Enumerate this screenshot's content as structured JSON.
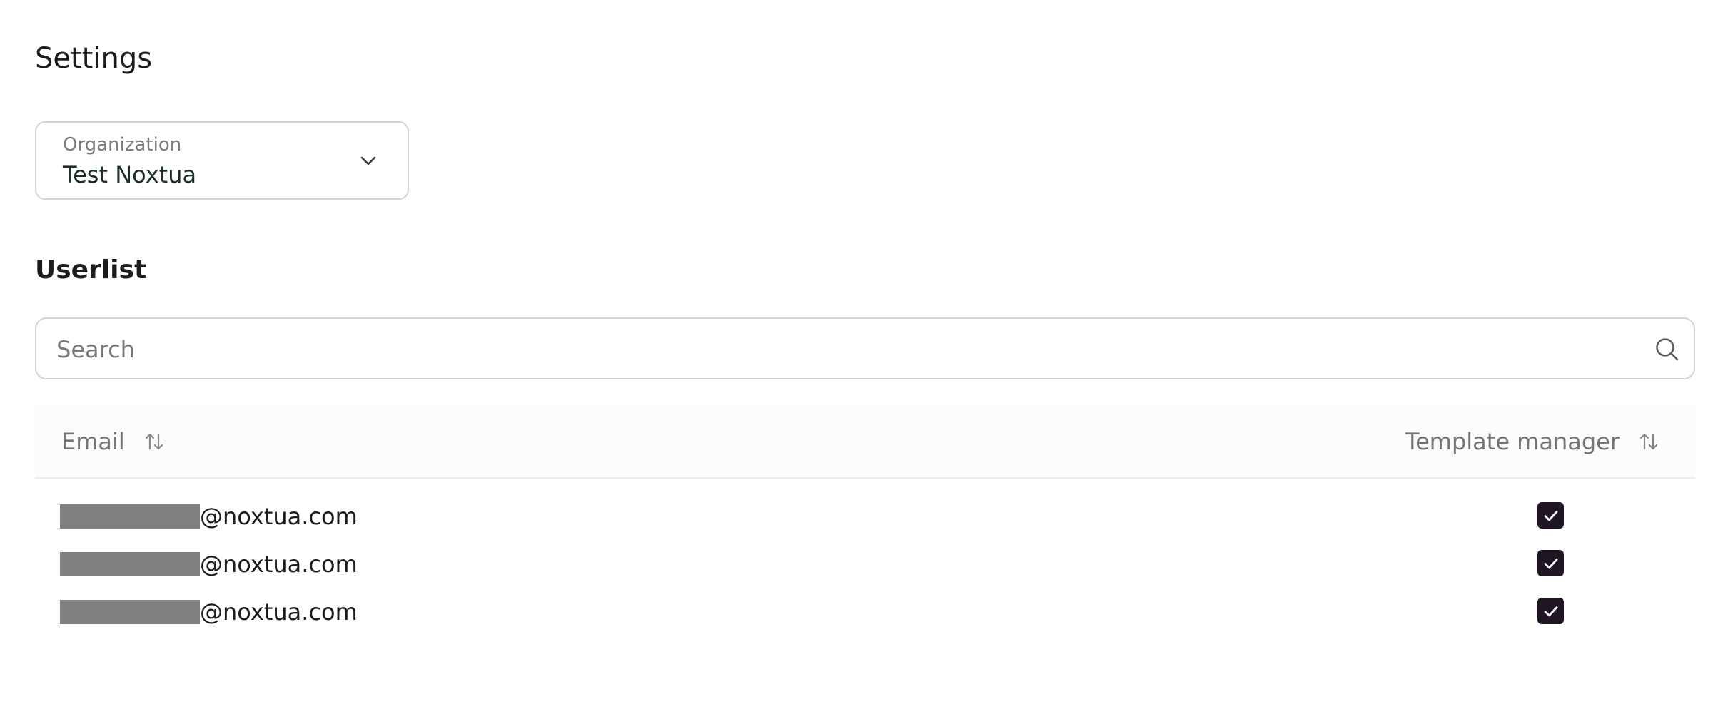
{
  "page": {
    "title": "Settings"
  },
  "organization": {
    "label": "Organization",
    "value": "Test Noxtua"
  },
  "userlist": {
    "title": "Userlist",
    "search_placeholder": "Search",
    "columns": {
      "email": "Email",
      "template_manager": "Template manager"
    },
    "rows": [
      {
        "email_suffix": "@noxtua.com",
        "template_manager": true
      },
      {
        "email_suffix": "@noxtua.com",
        "template_manager": true
      },
      {
        "email_suffix": "@noxtua.com",
        "template_manager": true
      }
    ]
  },
  "icons": {
    "organization_dropdown": "chevron-down-icon",
    "search": "search-icon",
    "sort": "sort-arrows-icon",
    "checkbox": "checkmark-icon"
  },
  "colors": {
    "checkbox_fill": "#1f1523",
    "border": "#d5d5d5",
    "muted_text": "#787472",
    "redaction": "#808080"
  }
}
